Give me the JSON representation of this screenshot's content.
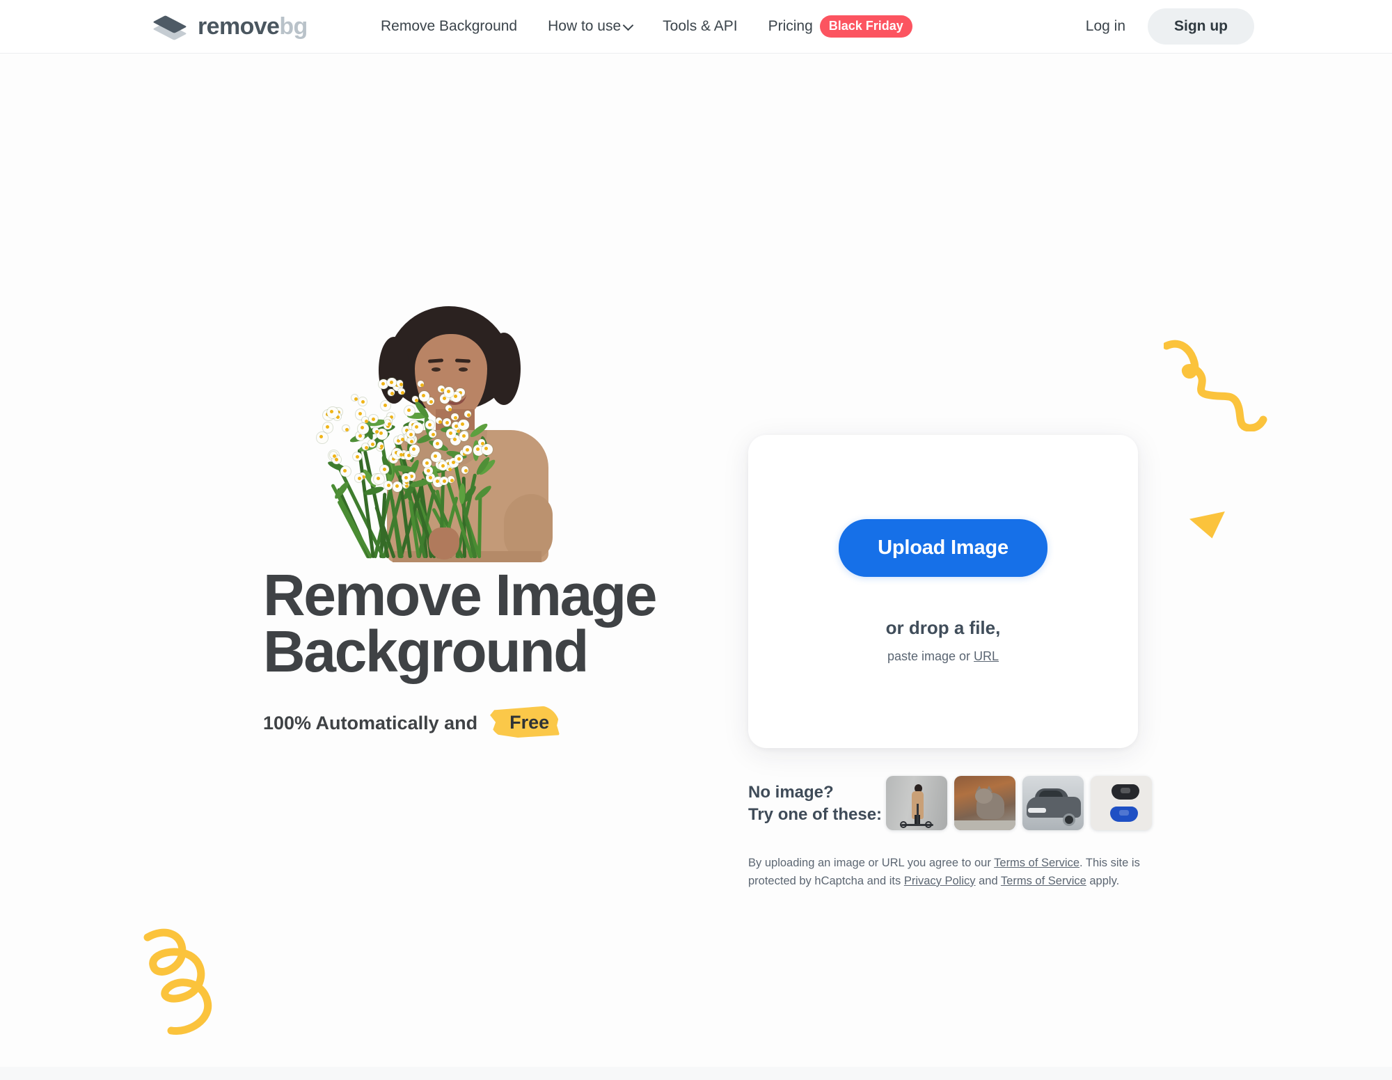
{
  "header": {
    "logo": {
      "primary": "remove",
      "secondary": "bg",
      "icon": "stacked-layers-icon"
    },
    "nav": [
      {
        "label": "Remove Background",
        "icon": null
      },
      {
        "label": "How to use",
        "icon": "chevron-down-icon"
      },
      {
        "label": "Tools & API",
        "icon": null
      }
    ],
    "pricing": {
      "label": "Pricing",
      "badge": "Black Friday",
      "badge_color": "#fc5460"
    },
    "login_label": "Log in",
    "signup_label": "Sign up"
  },
  "hero": {
    "title_line1": "Remove Image",
    "title_line2": "Background",
    "subtitle_prefix": "100% Automatically and",
    "subtitle_highlight": "Free",
    "highlight_color": "#fbc849",
    "image_alt": "woman-holding-flowers-photo"
  },
  "upload": {
    "button_label": "Upload Image",
    "button_color": "#1670e8",
    "drop_text": "or drop a file,",
    "paste_prefix": "paste image or",
    "paste_link": "URL"
  },
  "samples": {
    "label_line1": "No image?",
    "label_line2": "Try one of these:",
    "thumbnails": [
      {
        "name": "sample-woman-scooter"
      },
      {
        "name": "sample-cat"
      },
      {
        "name": "sample-car"
      },
      {
        "name": "sample-game-controllers"
      }
    ]
  },
  "legal": {
    "part1": "By uploading an image or URL you agree to our ",
    "link1": "Terms of Service",
    "part2": ". This site is protected by hCaptcha and its ",
    "link2": "Privacy Policy",
    "part3": " and ",
    "link3": "Terms of Service",
    "part4": " apply."
  },
  "decorations": {
    "squiggle_color": "#fbc33c",
    "triangle_color": "#fbc33c"
  }
}
